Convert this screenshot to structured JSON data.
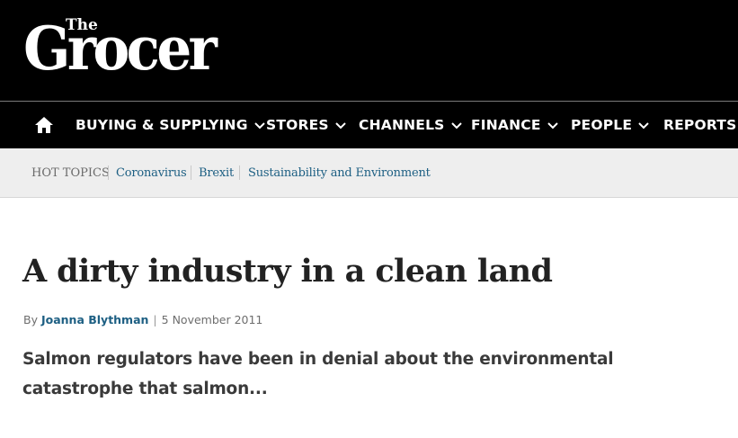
{
  "brand": {
    "logo_small": "The",
    "logo_main": "Grocer"
  },
  "nav": {
    "home_icon": "home-icon",
    "items": [
      {
        "label": "BUYING & SUPPLYING"
      },
      {
        "label": "STORES"
      },
      {
        "label": "CHANNELS"
      },
      {
        "label": "FINANCE"
      },
      {
        "label": "PEOPLE"
      },
      {
        "label": "REPORTS"
      }
    ]
  },
  "hot_topics": {
    "label": "HOT TOPICS",
    "links": [
      {
        "label": "Coronavirus"
      },
      {
        "label": "Brexit"
      },
      {
        "label": "Sustainability and Environment"
      }
    ]
  },
  "article": {
    "title": "A dirty industry in a clean land",
    "byline_prefix": "By",
    "author": "Joanna Blythman",
    "date": "5 November 2011",
    "standfirst": "Salmon regulators have been in denial about the environmental catastrophe that salmon..."
  },
  "colors": {
    "masthead_bg": "#000000",
    "link": "#1d5f83",
    "hotbar_bg": "#eeeeee",
    "headline": "#222222"
  }
}
